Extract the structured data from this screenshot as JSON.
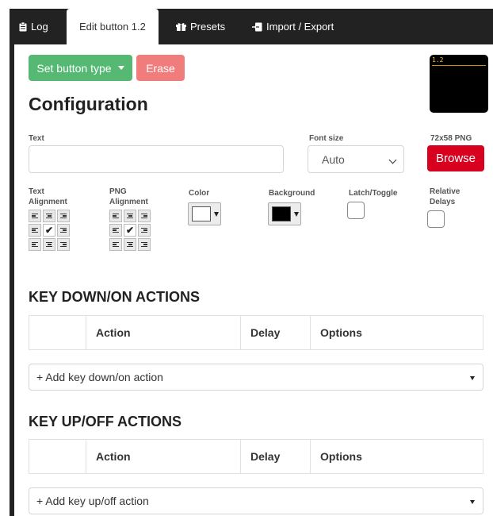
{
  "tabs": [
    {
      "label": "Log",
      "icon": "clipboard-icon"
    },
    {
      "label": "Edit button 1.2",
      "icon": ""
    },
    {
      "label": "Presets",
      "icon": "gift-icon"
    },
    {
      "label": "Import / Export",
      "icon": "import-export-icon"
    }
  ],
  "toolbar": {
    "set_type_label": "Set button type",
    "erase_label": "Erase"
  },
  "preview": {
    "label": "1.2"
  },
  "config": {
    "title": "Configuration",
    "text_label": "Text",
    "text_value": "",
    "font_size_label": "Font size",
    "font_size_value": "Auto",
    "png_label": "72x58 PNG",
    "browse_label": "Browse",
    "text_alignment_label": "Text Alignment",
    "png_alignment_label": "PNG Alignment",
    "color_label": "Color",
    "color_value": "#ffffff",
    "background_label": "Background",
    "background_value": "#000000",
    "latch_label": "Latch/Toggle",
    "relative_delays_label": "Relative Delays"
  },
  "key_down": {
    "title": "KEY DOWN/ON ACTIONS",
    "columns": [
      "",
      "Action",
      "Delay",
      "Options"
    ],
    "add_label": "+ Add key down/on action"
  },
  "key_up": {
    "title": "KEY UP/OFF ACTIONS",
    "columns": [
      "",
      "Action",
      "Delay",
      "Options"
    ],
    "add_label": "+ Add key up/off action"
  },
  "colors": {
    "green": "#56b973",
    "erase": "#f17c7c",
    "browse": "#d8001f",
    "tabbar": "#222222"
  }
}
